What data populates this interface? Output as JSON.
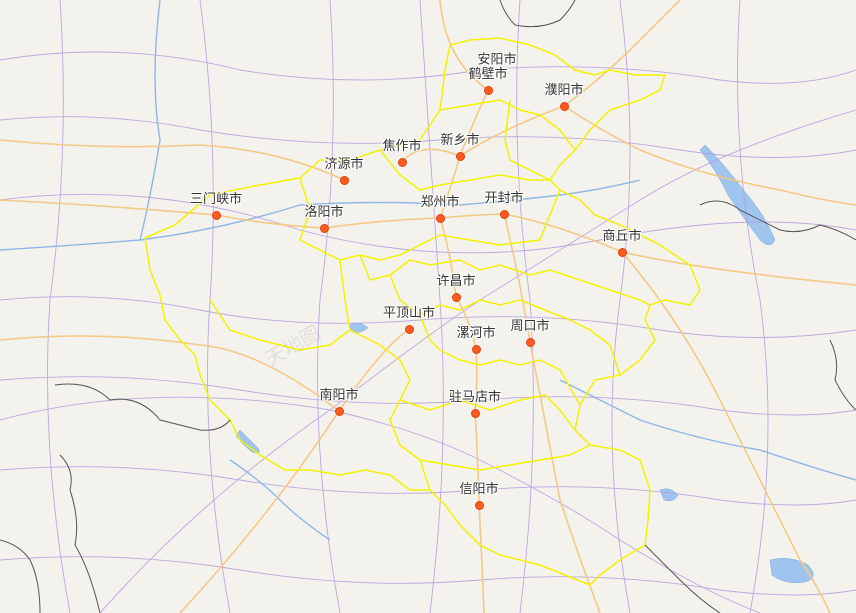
{
  "map": {
    "region_color": "#f2f200",
    "road_color_major": "#f5c887",
    "road_color_minor": "#a98ad8",
    "water_color": "#9fc4ee",
    "border_color": "#555555",
    "watermark": "天地图"
  },
  "cities": [
    {
      "name": "安阳市"
    },
    {
      "name": "鹤壁市"
    },
    {
      "name": "濮阳市"
    },
    {
      "name": "焦作市"
    },
    {
      "name": "新乡市"
    },
    {
      "name": "济源市"
    },
    {
      "name": "三门峡市"
    },
    {
      "name": "洛阳市"
    },
    {
      "name": "郑州市"
    },
    {
      "name": "开封市"
    },
    {
      "name": "商丘市"
    },
    {
      "name": "许昌市"
    },
    {
      "name": "平顶山市"
    },
    {
      "name": "漯河市"
    },
    {
      "name": "周口市"
    },
    {
      "name": "南阳市"
    },
    {
      "name": "驻马店市"
    },
    {
      "name": "信阳市"
    }
  ]
}
